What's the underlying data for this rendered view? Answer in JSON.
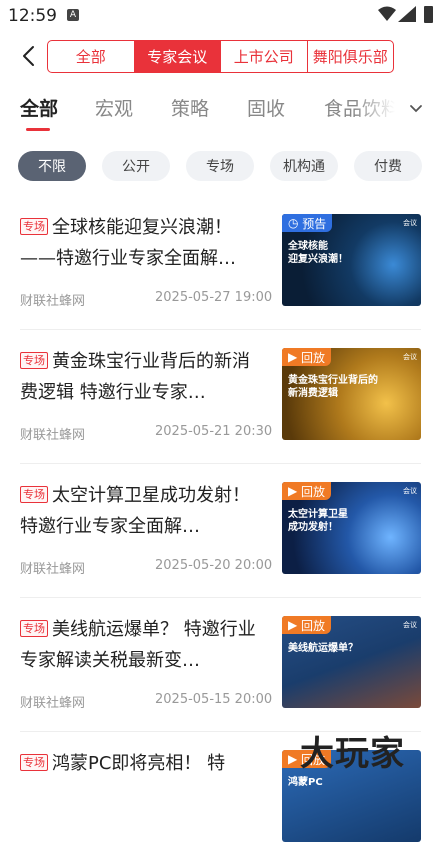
{
  "status_bar": {
    "time": "12:59",
    "a_icon": "A"
  },
  "segments": [
    {
      "label": "全部",
      "active": false
    },
    {
      "label": "专家会议",
      "active": true
    },
    {
      "label": "上市公司",
      "active": false
    },
    {
      "label": "舞阳俱乐部",
      "active": false
    }
  ],
  "categories": [
    {
      "label": "全部",
      "active": true
    },
    {
      "label": "宏观",
      "active": false
    },
    {
      "label": "策略",
      "active": false
    },
    {
      "label": "固收",
      "active": false
    },
    {
      "label": "食品饮料",
      "active": false
    }
  ],
  "filters": [
    {
      "label": "不限",
      "active": true
    },
    {
      "label": "公开",
      "active": false
    },
    {
      "label": "专场",
      "active": false
    },
    {
      "label": "机构通",
      "active": false
    },
    {
      "label": "付费",
      "active": false
    }
  ],
  "items": [
    {
      "tag": "专场",
      "title": "全球核能迎复兴浪潮！——特邀行业专家全面解…",
      "source": "财联社蜂网",
      "date": "2025-05-27 19:00",
      "badge": "预告",
      "badge_color": "#2f6fe0",
      "thumb_title_1": "全球核能",
      "thumb_title_2": "迎复兴浪潮！",
      "thumb_bg": "#0f2e4d",
      "thumb_corner": "会议"
    },
    {
      "tag": "专场",
      "title": "黄金珠宝行业背后的新消费逻辑 特邀行业专家…",
      "source": "财联社蜂网",
      "date": "2025-05-21 20:30",
      "badge": "回放",
      "badge_color": "#f07a25",
      "thumb_title_1": "黄金珠宝行业背后的",
      "thumb_title_2": "新消费逻辑",
      "thumb_bg": "#8a5a12",
      "thumb_corner": "会议"
    },
    {
      "tag": "专场",
      "title": "太空计算卫星成功发射！ 特邀行业专家全面解…",
      "source": "财联社蜂网",
      "date": "2025-05-20 20:00",
      "badge": "回放",
      "badge_color": "#f07a25",
      "thumb_title_1": "太空计算卫星",
      "thumb_title_2": "成功发射！",
      "thumb_bg": "#14325e",
      "thumb_corner": "会议"
    },
    {
      "tag": "专场",
      "title": "美线航运爆单？ 特邀行业专家解读关税最新变…",
      "source": "财联社蜂网",
      "date": "2025-05-15 20:00",
      "badge": "回放",
      "badge_color": "#f07a25",
      "thumb_title_1": "美线航运爆单？",
      "thumb_title_2": "",
      "thumb_bg": "#1d3f6e",
      "thumb_corner": "会议"
    },
    {
      "tag": "专场",
      "title": "鸿蒙PC即将亮相！ 特",
      "source": "",
      "date": "",
      "badge": "回放",
      "badge_color": "#f07a25",
      "thumb_title_1": "鸿蒙PC",
      "thumb_title_2": "",
      "thumb_bg": "#1a4a80",
      "thumb_corner": ""
    }
  ],
  "watermark": "大玩家"
}
